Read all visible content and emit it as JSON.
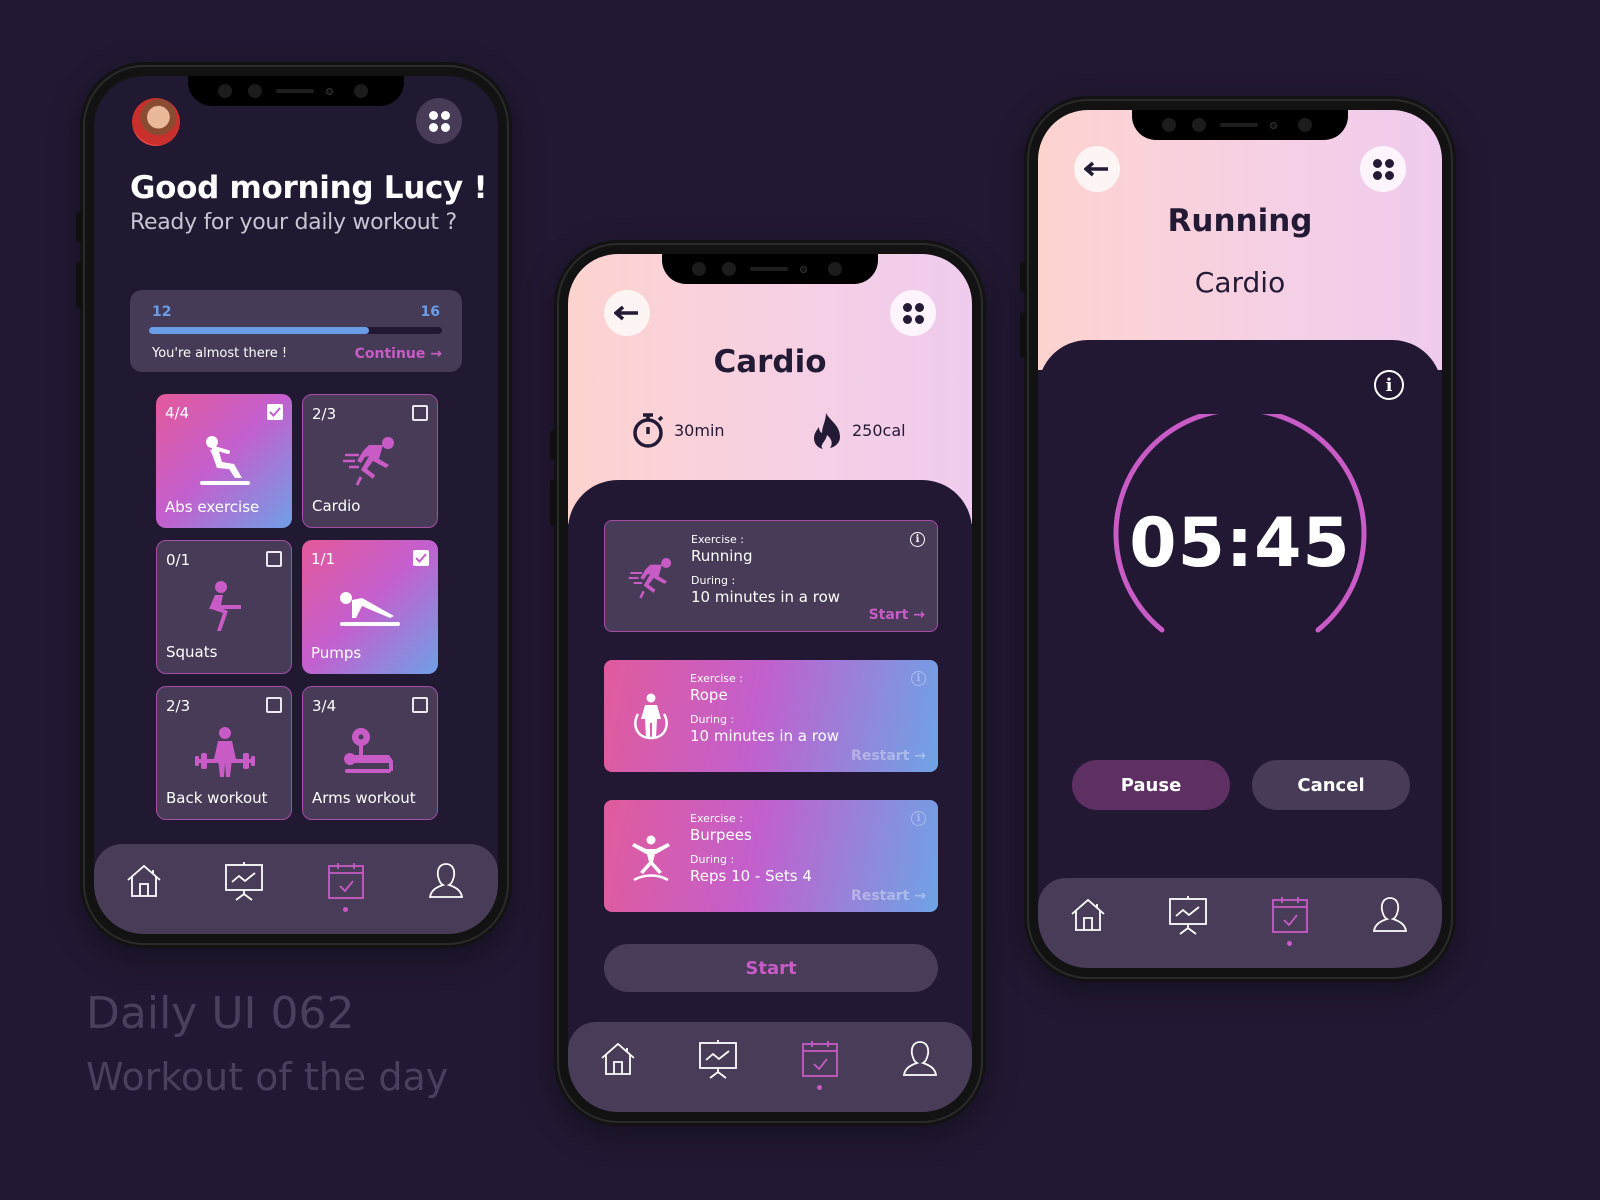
{
  "colors": {
    "background": "#221833",
    "accent": "#c85bc6",
    "progress": "#6a9de8",
    "card": "#473b57",
    "header_pink": "#fdd3cf"
  },
  "caption": {
    "title": "Daily UI 062",
    "subtitle": "Workout of the day"
  },
  "home": {
    "greeting": "Good morning Lucy !",
    "subtitle": "Ready for your daily workout ?",
    "progress": {
      "current": "12",
      "total": "16",
      "fraction": 0.75,
      "message": "You're almost there !",
      "continue_label": "Continue →"
    },
    "workouts": [
      {
        "count": "4/4",
        "label": "Abs exercise",
        "checked": true,
        "icon": "situp-icon"
      },
      {
        "count": "2/3",
        "label": "Cardio",
        "checked": false,
        "icon": "running-icon"
      },
      {
        "count": "0/1",
        "label": "Squats",
        "checked": false,
        "icon": "squat-icon"
      },
      {
        "count": "1/1",
        "label": "Pumps",
        "checked": true,
        "icon": "pushup-icon"
      },
      {
        "count": "2/3",
        "label": "Back workout",
        "checked": false,
        "icon": "deadlift-icon"
      },
      {
        "count": "3/4",
        "label": "Arms workout",
        "checked": false,
        "icon": "bench-press-icon"
      }
    ]
  },
  "cardio": {
    "title": "Cardio",
    "duration": "30min",
    "calories": "250cal",
    "exercise_key": "Exercise :",
    "during_key": "During :",
    "exercises": [
      {
        "name": "Running",
        "during": "10 minutes in a row",
        "action": "Start →",
        "icon": "running-icon"
      },
      {
        "name": "Rope",
        "during": "10 minutes in a row",
        "action": "Restart →",
        "icon": "jump-rope-icon"
      },
      {
        "name": "Burpees",
        "during": "Reps 10 - Sets 4",
        "action": "Restart →",
        "icon": "jumping-jack-icon"
      }
    ],
    "start_label": "Start"
  },
  "timer": {
    "title": "Running",
    "category": "Cardio",
    "time": "05:45",
    "pause_label": "Pause",
    "cancel_label": "Cancel"
  },
  "nav": {
    "items": [
      "home",
      "statistics",
      "calendar",
      "profile"
    ],
    "active": "calendar"
  }
}
